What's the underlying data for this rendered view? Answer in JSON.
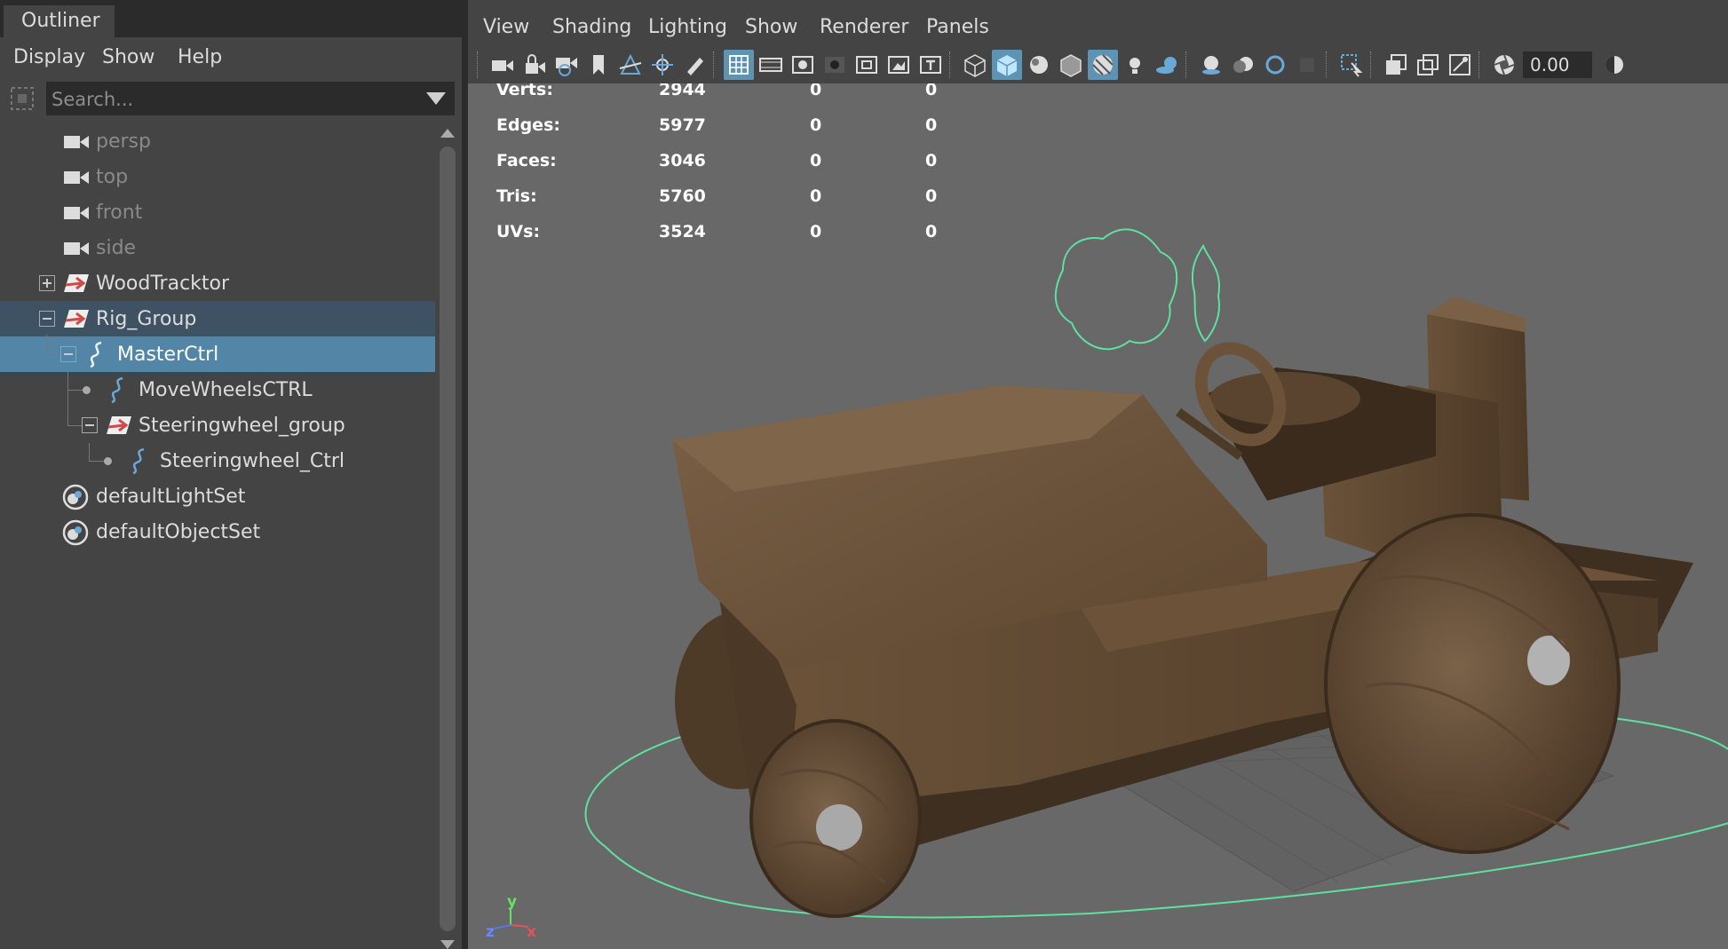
{
  "outliner": {
    "tab_label": "Outliner",
    "menu": [
      "Display",
      "Show",
      "Help"
    ],
    "search_placeholder": "Search...",
    "items": [
      {
        "label": "persp",
        "icon": "camera-icon"
      },
      {
        "label": "top",
        "icon": "camera-icon"
      },
      {
        "label": "front",
        "icon": "camera-icon"
      },
      {
        "label": "side",
        "icon": "camera-icon"
      },
      {
        "label": "WoodTracktor",
        "icon": "transform-group-icon"
      },
      {
        "label": "Rig_Group",
        "icon": "transform-group-icon"
      },
      {
        "label": "MasterCtrl",
        "icon": "nurbs-curve-icon"
      },
      {
        "label": "MoveWheelsCTRL",
        "icon": "nurbs-curve-icon"
      },
      {
        "label": "Steeringwheel_group",
        "icon": "transform-group-icon"
      },
      {
        "label": "Steeringwheel_Ctrl",
        "icon": "nurbs-curve-icon"
      },
      {
        "label": "defaultLightSet",
        "icon": "set-icon"
      },
      {
        "label": "defaultObjectSet",
        "icon": "set-icon"
      }
    ]
  },
  "panel": {
    "menu": [
      "View",
      "Shading",
      "Lighting",
      "Show",
      "Renderer",
      "Panels"
    ],
    "exposure_value": "0.00"
  },
  "hud": {
    "rows": [
      {
        "label": "Verts:",
        "value": "2944",
        "c2": "0",
        "c3": "0"
      },
      {
        "label": "Edges:",
        "value": "5977",
        "c2": "0",
        "c3": "0"
      },
      {
        "label": "Faces:",
        "value": "3046",
        "c2": "0",
        "c3": "0"
      },
      {
        "label": "Tris:",
        "value": "5760",
        "c2": "0",
        "c3": "0"
      },
      {
        "label": "UVs:",
        "value": "3524",
        "c2": "0",
        "c3": "0"
      }
    ]
  },
  "axis": {
    "y": "y",
    "z": "z",
    "x": "x"
  },
  "colors": {
    "selection": "#5285a6",
    "selection_parent": "#3f5263",
    "toolbar_active": "#5d93b3",
    "control_curve": "#5fe0a0",
    "transform_icon": "#d14a4a",
    "curve_icon": "#6aa8d8"
  }
}
